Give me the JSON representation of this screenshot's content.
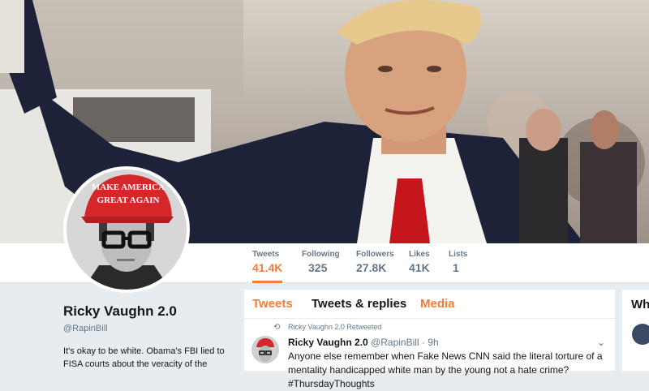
{
  "stats": [
    {
      "label": "Tweets",
      "value": "41.4K",
      "active": true
    },
    {
      "label": "Following",
      "value": "325"
    },
    {
      "label": "Followers",
      "value": "27.8K"
    },
    {
      "label": "Likes",
      "value": "41K"
    },
    {
      "label": "Lists",
      "value": "1"
    }
  ],
  "avatar_hat_text": "MAKE AMERICA GREAT AGAIN",
  "profile": {
    "name": "Ricky Vaughn 2.0",
    "handle": "@RapinBill",
    "bio": "It's okay to be white. Obama's FBI lied to FISA courts about the veracity of the"
  },
  "tabs": {
    "tweets": "Tweets",
    "replies": "Tweets & replies",
    "media": "Media"
  },
  "tweet": {
    "retweet_line": "Ricky Vaughn 2.0 Retweeted",
    "author_name": "Ricky Vaughn 2.0",
    "author_handle": "@RapinBill",
    "time": "· 9h",
    "text": "Anyone else remember when Fake News CNN said the literal torture of a mentality handicapped white man by the young not a hate crime? #ThursdayThoughts"
  },
  "right": {
    "title": "Wh"
  },
  "colors": {
    "accent": "#f57c3a",
    "text": "#14171a",
    "muted": "#657786",
    "background": "#e6ecf0"
  }
}
